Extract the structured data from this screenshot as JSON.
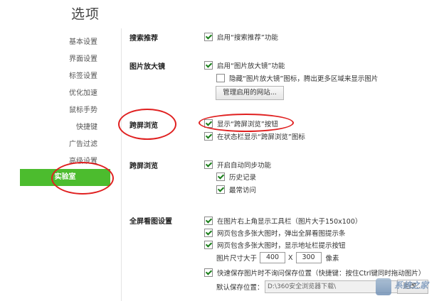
{
  "page": {
    "title": "选项"
  },
  "sidebar": {
    "items": [
      {
        "label": "基本设置"
      },
      {
        "label": "界面设置"
      },
      {
        "label": "标签设置"
      },
      {
        "label": "优化加速"
      },
      {
        "label": "鼠标手势"
      },
      {
        "label": "快捷键"
      },
      {
        "label": "广告过滤"
      },
      {
        "label": "高级设置"
      },
      {
        "label": "实验室",
        "active": true
      }
    ]
  },
  "sections": {
    "search_recommend": {
      "title": "搜索推荐",
      "options": [
        {
          "label": "启用“搜索推荐”功能",
          "checked": true
        }
      ]
    },
    "magnifier": {
      "title": "图片放大镜",
      "options": [
        {
          "label": "启用“图片放大镜”功能",
          "checked": true
        },
        {
          "label": "隐藏“图片放大镜”图标，腾出更多区域来显示图片",
          "checked": false
        }
      ],
      "button": "管理启用的网站..."
    },
    "cross_screen": {
      "title": "跨屏浏览",
      "options": [
        {
          "label": "显示“跨屏浏览”按钮",
          "checked": true
        },
        {
          "label": "在状态栏显示“跨屏浏览”图标",
          "checked": true
        }
      ]
    },
    "sync": {
      "title": "跨屏浏览",
      "options": [
        {
          "label": "开启自动同步功能",
          "checked": true
        },
        {
          "label": "历史记录",
          "checked": true
        },
        {
          "label": "最常访问",
          "checked": true
        }
      ]
    },
    "fullscreen": {
      "title": "全屏看图设置",
      "options": [
        {
          "label": "在图片右上角显示工具栏（图片大于150x100）",
          "checked": true
        },
        {
          "label": "网页包含多张大图时，弹出全屏看图提示条",
          "checked": true
        },
        {
          "label": "网页包含多张大图时，显示地址栏提示按钮",
          "checked": true
        },
        {
          "label": "快速保存图片时不询问保存位置（快捷键：按住Ctrl键同时拖动图片）",
          "checked": true
        }
      ],
      "size_label": "图片尺寸大于",
      "size_w": "400",
      "size_x": "X",
      "size_h": "300",
      "size_unit": "像素",
      "save_label": "默认保存位置：",
      "save_path": "D:\\360安全浏览器下载\\",
      "change_button": "更改..."
    }
  },
  "colors": {
    "active_green": "#4cbc2e",
    "annotation_red": "#e02020"
  },
  "watermark": {
    "text": "系统之家"
  }
}
